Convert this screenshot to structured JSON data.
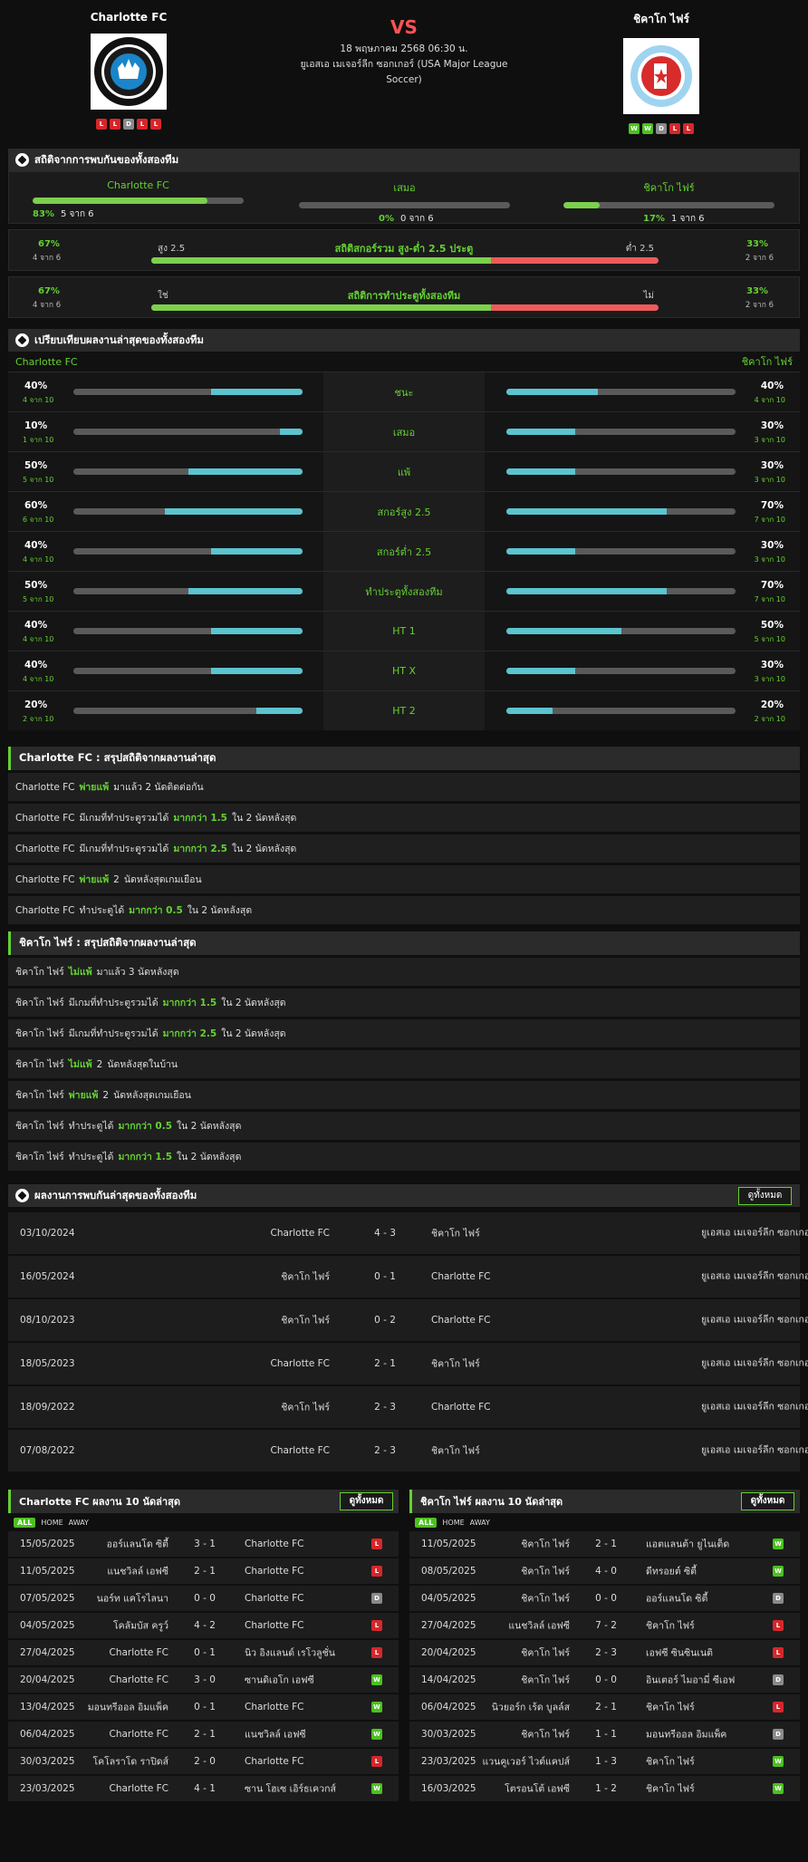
{
  "header": {
    "home": {
      "name": "Charlotte FC",
      "form": [
        "L",
        "L",
        "D",
        "L",
        "L"
      ]
    },
    "away": {
      "name": "ชิคาโก ไฟร์",
      "form": [
        "W",
        "W",
        "D",
        "L",
        "L"
      ]
    },
    "vs": "VS",
    "date": "18 พฤษภาคม 2568 06:30 น.",
    "competition": "ยูเอสเอ เมเจอร์ลีก ซอกเกอร์ (USA Major League Soccer)"
  },
  "h2h_stats": {
    "title": "สถิติจากการพบกันของทั้งสองทีม",
    "home": {
      "name": "Charlotte FC",
      "pct": "83%",
      "sub": "5 จาก 6",
      "value": 0.83
    },
    "draw": {
      "name": "เสมอ",
      "pct": "0%",
      "sub": "0 จาก 6",
      "value": 0
    },
    "away": {
      "name": "ชิคาโก ไฟร์",
      "pct": "17%",
      "sub": "1 จาก 6",
      "value": 0.17
    },
    "ou": {
      "left_pct": "67%",
      "left_sub": "4 จาก 6",
      "left_label": "สูง 2.5",
      "title": "สถิติสกอร์รวม สูง-ต่ำ 2.5 ประตู",
      "right_label": "ต่ำ 2.5",
      "right_pct": "33%",
      "right_sub": "2 จาก 6",
      "value": 0.67
    },
    "btts": {
      "left_pct": "67%",
      "left_sub": "4 จาก 6",
      "left_label": "ใช่",
      "title": "สถิติการทำประตูทั้งสองทีม",
      "right_label": "ไม่",
      "right_pct": "33%",
      "right_sub": "2 จาก 6",
      "value": 0.67
    }
  },
  "compare": {
    "title": "เปรียบเทียบผลงานล่าสุดของทั้งสองทีม",
    "home": "Charlotte FC",
    "away": "ชิคาโก ไฟร์",
    "rows": [
      {
        "label": "ชนะ",
        "lp": "40%",
        "ls": "4 จาก 10",
        "lv": 0.4,
        "rp": "40%",
        "rs": "4 จาก 10",
        "rv": 0.4
      },
      {
        "label": "เสมอ",
        "lp": "10%",
        "ls": "1 จาก 10",
        "lv": 0.1,
        "rp": "30%",
        "rs": "3 จาก 10",
        "rv": 0.3
      },
      {
        "label": "แพ้",
        "lp": "50%",
        "ls": "5 จาก 10",
        "lv": 0.5,
        "rp": "30%",
        "rs": "3 จาก 10",
        "rv": 0.3
      },
      {
        "label": "สกอร์สูง 2.5",
        "lp": "60%",
        "ls": "6 จาก 10",
        "lv": 0.6,
        "rp": "70%",
        "rs": "7 จาก 10",
        "rv": 0.7
      },
      {
        "label": "สกอร์ต่ำ 2.5",
        "lp": "40%",
        "ls": "4 จาก 10",
        "lv": 0.4,
        "rp": "30%",
        "rs": "3 จาก 10",
        "rv": 0.3
      },
      {
        "label": "ทำประตูทั้งสองทีม",
        "lp": "50%",
        "ls": "5 จาก 10",
        "lv": 0.5,
        "rp": "70%",
        "rs": "7 จาก 10",
        "rv": 0.7
      },
      {
        "label": "HT 1",
        "lp": "40%",
        "ls": "4 จาก 10",
        "lv": 0.4,
        "rp": "50%",
        "rs": "5 จาก 10",
        "rv": 0.5
      },
      {
        "label": "HT X",
        "lp": "40%",
        "ls": "4 จาก 10",
        "lv": 0.4,
        "rp": "30%",
        "rs": "3 จาก 10",
        "rv": 0.3
      },
      {
        "label": "HT 2",
        "lp": "20%",
        "ls": "2 จาก 10",
        "lv": 0.2,
        "rp": "20%",
        "rs": "2 จาก 10",
        "rv": 0.2
      }
    ]
  },
  "home_summary": {
    "title": "Charlotte FC : สรุปสถิติจากผลงานล่าสุด",
    "rows": [
      [
        {
          "t": "Charlotte FC"
        },
        {
          "t": "พ่ายแพ้",
          "g": 1
        },
        {
          "t": "มาแล้ว 2 นัดติดต่อกัน"
        }
      ],
      [
        {
          "t": "Charlotte FC"
        },
        {
          "t": "มีเกมที่ทำประตูรวมได้"
        },
        {
          "t": "มากกว่า 1.5",
          "g": 1
        },
        {
          "t": "ใน 2 นัดหลังสุด"
        }
      ],
      [
        {
          "t": "Charlotte FC"
        },
        {
          "t": "มีเกมที่ทำประตูรวมได้"
        },
        {
          "t": "มากกว่า 2.5",
          "g": 1
        },
        {
          "t": "ใน 2 นัดหลังสุด"
        }
      ],
      [
        {
          "t": "Charlotte FC"
        },
        {
          "t": "พ่ายแพ้",
          "g": 1
        },
        {
          "t": "2"
        },
        {
          "t": "นัดหลังสุดเกมเยือน"
        }
      ],
      [
        {
          "t": "Charlotte FC"
        },
        {
          "t": "ทำประตูได้"
        },
        {
          "t": "มากกว่า 0.5",
          "g": 1
        },
        {
          "t": "ใน 2 นัดหลังสุด"
        }
      ]
    ]
  },
  "away_summary": {
    "title": "ชิคาโก ไฟร์ : สรุปสถิติจากผลงานล่าสุด",
    "rows": [
      [
        {
          "t": "ชิคาโก ไฟร์"
        },
        {
          "t": "ไม่แพ้",
          "g": 1
        },
        {
          "t": "มาแล้ว 3 นัดหลังสุด"
        }
      ],
      [
        {
          "t": "ชิคาโก ไฟร์"
        },
        {
          "t": "มีเกมที่ทำประตูรวมได้"
        },
        {
          "t": "มากกว่า 1.5",
          "g": 1
        },
        {
          "t": "ใน 2 นัดหลังสุด"
        }
      ],
      [
        {
          "t": "ชิคาโก ไฟร์"
        },
        {
          "t": "มีเกมที่ทำประตูรวมได้"
        },
        {
          "t": "มากกว่า 2.5",
          "g": 1
        },
        {
          "t": "ใน 2 นัดหลังสุด"
        }
      ],
      [
        {
          "t": "ชิคาโก ไฟร์"
        },
        {
          "t": "ไม่แพ้",
          "g": 1
        },
        {
          "t": "2"
        },
        {
          "t": "นัดหลังสุดในบ้าน"
        }
      ],
      [
        {
          "t": "ชิคาโก ไฟร์"
        },
        {
          "t": "พ่ายแพ้",
          "g": 1
        },
        {
          "t": "2"
        },
        {
          "t": "นัดหลังสุดเกมเยือน"
        }
      ],
      [
        {
          "t": "ชิคาโก ไฟร์"
        },
        {
          "t": "ทำประตูได้"
        },
        {
          "t": "มากกว่า 0.5",
          "g": 1
        },
        {
          "t": "ใน 2 นัดหลังสุด"
        }
      ],
      [
        {
          "t": "ชิคาโก ไฟร์"
        },
        {
          "t": "ทำประตูได้"
        },
        {
          "t": "มากกว่า 1.5",
          "g": 1
        },
        {
          "t": "ใน 2 นัดหลังสุด"
        }
      ]
    ]
  },
  "h2h_matches": {
    "title": "ผลงานการพบกันล่าสุดของทั้งสองทีม",
    "all_label": "ดูทั้งหมด",
    "rows": [
      {
        "date": "03/10/2024",
        "home": "Charlotte FC",
        "score": "4 - 3",
        "away": "ชิคาโก ไฟร์",
        "venue": "ยูเอสเอ เมเจอร์ลีก ซอกเกอร์"
      },
      {
        "date": "16/05/2024",
        "home": "ชิคาโก ไฟร์",
        "score": "0 - 1",
        "away": "Charlotte FC",
        "venue": "ยูเอสเอ เมเจอร์ลีก ซอกเกอร์"
      },
      {
        "date": "08/10/2023",
        "home": "ชิคาโก ไฟร์",
        "score": "0 - 2",
        "away": "Charlotte FC",
        "venue": "ยูเอสเอ เมเจอร์ลีก ซอกเกอร์"
      },
      {
        "date": "18/05/2023",
        "home": "Charlotte FC",
        "score": "2 - 1",
        "away": "ชิคาโก ไฟร์",
        "venue": "ยูเอสเอ เมเจอร์ลีก ซอกเกอร์"
      },
      {
        "date": "18/09/2022",
        "home": "ชิคาโก ไฟร์",
        "score": "2 - 3",
        "away": "Charlotte FC",
        "venue": "ยูเอสเอ เมเจอร์ลีก ซอกเกอร์"
      },
      {
        "date": "07/08/2022",
        "home": "Charlotte FC",
        "score": "2 - 3",
        "away": "ชิคาโก ไฟร์",
        "venue": "ยูเอสเอ เมเจอร์ลีก ซอกเกอร์"
      }
    ]
  },
  "filters": {
    "all": "ALL",
    "home": "HOME",
    "away": "AWAY"
  },
  "home_last10": {
    "title": "Charlotte FC ผลงาน 10 นัดล่าสุด",
    "all_label": "ดูทั้งหมด",
    "rows": [
      {
        "date": "15/05/2025",
        "home": "ออร์แลนโด ซิตี้",
        "score": "3 - 1",
        "away": "Charlotte FC",
        "res": "L"
      },
      {
        "date": "11/05/2025",
        "home": "แนชวิลล์ เอฟซี",
        "score": "2 - 1",
        "away": "Charlotte FC",
        "res": "L"
      },
      {
        "date": "07/05/2025",
        "home": "นอร์ท แคโรไลนา",
        "score": "0 - 0",
        "away": "Charlotte FC",
        "res": "D"
      },
      {
        "date": "04/05/2025",
        "home": "โคลัมบัส ครูว์",
        "score": "4 - 2",
        "away": "Charlotte FC",
        "res": "L"
      },
      {
        "date": "27/04/2025",
        "home": "Charlotte FC",
        "score": "0 - 1",
        "away": "นิว อิงแลนด์ เรโวลูชั่น",
        "res": "L"
      },
      {
        "date": "20/04/2025",
        "home": "Charlotte FC",
        "score": "3 - 0",
        "away": "ซานดิเอโก เอฟซี",
        "res": "W"
      },
      {
        "date": "13/04/2025",
        "home": "มอนทรีออล อิมแพ็ค",
        "score": "0 - 1",
        "away": "Charlotte FC",
        "res": "W"
      },
      {
        "date": "06/04/2025",
        "home": "Charlotte FC",
        "score": "2 - 1",
        "away": "แนชวิลล์ เอฟซี",
        "res": "W"
      },
      {
        "date": "30/03/2025",
        "home": "โคโลราโด ราปิดส์",
        "score": "2 - 0",
        "away": "Charlotte FC",
        "res": "L"
      },
      {
        "date": "23/03/2025",
        "home": "Charlotte FC",
        "score": "4 - 1",
        "away": "ซาน โฮเซ เอิร์ธเควกส์",
        "res": "W"
      }
    ]
  },
  "away_last10": {
    "title": "ชิคาโก ไฟร์ ผลงาน 10 นัดล่าสุด",
    "all_label": "ดูทั้งหมด",
    "rows": [
      {
        "date": "11/05/2025",
        "home": "ชิคาโก ไฟร์",
        "score": "2 - 1",
        "away": "แอตแลนต้า ยูไนเต็ด",
        "res": "W"
      },
      {
        "date": "08/05/2025",
        "home": "ชิคาโก ไฟร์",
        "score": "4 - 0",
        "away": "ดีทรอยต์ ซิตี้",
        "res": "W"
      },
      {
        "date": "04/05/2025",
        "home": "ชิคาโก ไฟร์",
        "score": "0 - 0",
        "away": "ออร์แลนโด ซิตี้",
        "res": "D"
      },
      {
        "date": "27/04/2025",
        "home": "แนชวิลล์ เอฟซี",
        "score": "7 - 2",
        "away": "ชิคาโก ไฟร์",
        "res": "L"
      },
      {
        "date": "20/04/2025",
        "home": "ชิคาโก ไฟร์",
        "score": "2 - 3",
        "away": "เอฟซี ซินซินเนติ",
        "res": "L"
      },
      {
        "date": "14/04/2025",
        "home": "ชิคาโก ไฟร์",
        "score": "0 - 0",
        "away": "อินเตอร์ ไมอามี่ ซีเอฟ",
        "res": "D"
      },
      {
        "date": "06/04/2025",
        "home": "นิวยอร์ก เร้ด บูลล์ส",
        "score": "2 - 1",
        "away": "ชิคาโก ไฟร์",
        "res": "L"
      },
      {
        "date": "30/03/2025",
        "home": "ชิคาโก ไฟร์",
        "score": "1 - 1",
        "away": "มอนทรีออล อิมแพ็ค",
        "res": "D"
      },
      {
        "date": "23/03/2025",
        "home": "แวนคูเวอร์ ไวต์แคปส์",
        "score": "1 - 3",
        "away": "ชิคาโก ไฟร์",
        "res": "W"
      },
      {
        "date": "16/03/2025",
        "home": "โตรอนโต้ เอฟซี",
        "score": "1 - 2",
        "away": "ชิคาโก ไฟร์",
        "res": "W"
      }
    ]
  }
}
